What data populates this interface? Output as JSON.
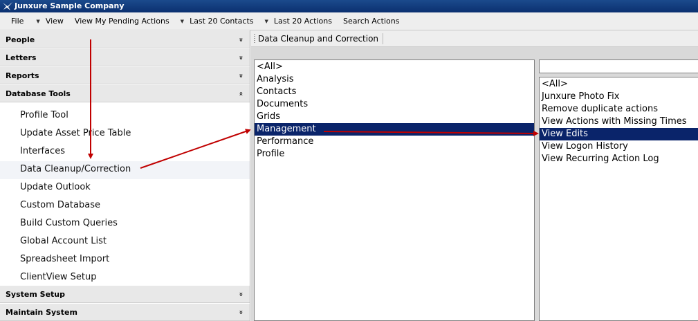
{
  "window": {
    "title": "Junxure Sample Company"
  },
  "menu": [
    {
      "label": "File",
      "dropdown": false
    },
    {
      "label": "View",
      "dropdown": true
    },
    {
      "label": "View My Pending Actions",
      "dropdown": false
    },
    {
      "label": "Last 20 Contacts",
      "dropdown": true
    },
    {
      "label": "Last 20 Actions",
      "dropdown": true
    },
    {
      "label": "Search Actions",
      "dropdown": false
    }
  ],
  "sidebar": {
    "sections_top": [
      {
        "label": "People",
        "chevron": "»"
      },
      {
        "label": "Letters",
        "chevron": "»"
      },
      {
        "label": "Reports",
        "chevron": "»"
      },
      {
        "label": "Database Tools",
        "chevron": "«"
      }
    ],
    "tools": [
      "Profile Tool",
      "Update Asset Price Table",
      "Interfaces",
      "Data Cleanup/Correction",
      "Update Outlook",
      "Custom Database",
      "Build Custom Queries",
      "Global Account List",
      "Spreadsheet Import",
      "ClientView Setup"
    ],
    "sections_bottom": [
      {
        "label": "System Setup",
        "chevron": "»"
      },
      {
        "label": "Maintain System",
        "chevron": "»"
      }
    ]
  },
  "main": {
    "tab_label": "Data Cleanup and Correction",
    "categories": [
      "<All>",
      "Analysis",
      "Contacts",
      "Documents",
      "Grids",
      "Management",
      "Performance",
      "Profile"
    ],
    "selected_category": "Management",
    "filter": {
      "value": ""
    },
    "reports": [
      "<All>",
      "Junxure Photo Fix",
      "Remove duplicate actions",
      "View Actions with Missing Times",
      "View Edits",
      "View Logon History",
      "View Recurring Action Log"
    ],
    "selected_report": "View Edits"
  },
  "colors": {
    "selection": "#0a246a",
    "annotation_arrow": "#c00000",
    "titlebar": "#0b3070"
  }
}
